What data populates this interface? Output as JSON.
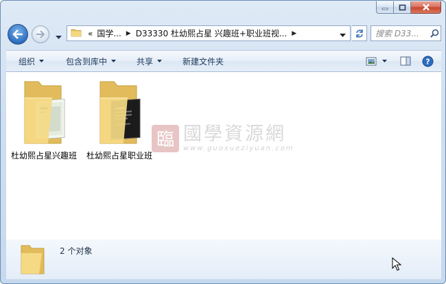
{
  "nav": {
    "breadcrumb": [
      {
        "label": "«"
      },
      {
        "label": "国学..."
      },
      {
        "label": "D33330 杜幼熙占星 兴趣班+职业班视..."
      }
    ],
    "search_placeholder": "搜索 D33..."
  },
  "toolbar": {
    "organize": "组织",
    "include_in_library": "包含到库中",
    "share": "共享",
    "new_folder": "新建文件夹"
  },
  "items": [
    {
      "label": "杜幼熙占星兴趣班",
      "preview": "light-document"
    },
    {
      "label": "杜幼熙占星职业班",
      "preview": "dark-document"
    }
  ],
  "watermark": {
    "seal": "臨",
    "name": "國學資源網",
    "url": "www.guoxueziyuan.com"
  },
  "status": {
    "count_text": "2 个对象"
  },
  "colors": {
    "frame": "#c6d9ee",
    "toolbar_text": "#1e395b",
    "close_button": "#c7432b",
    "folder": "#f2d37c"
  }
}
